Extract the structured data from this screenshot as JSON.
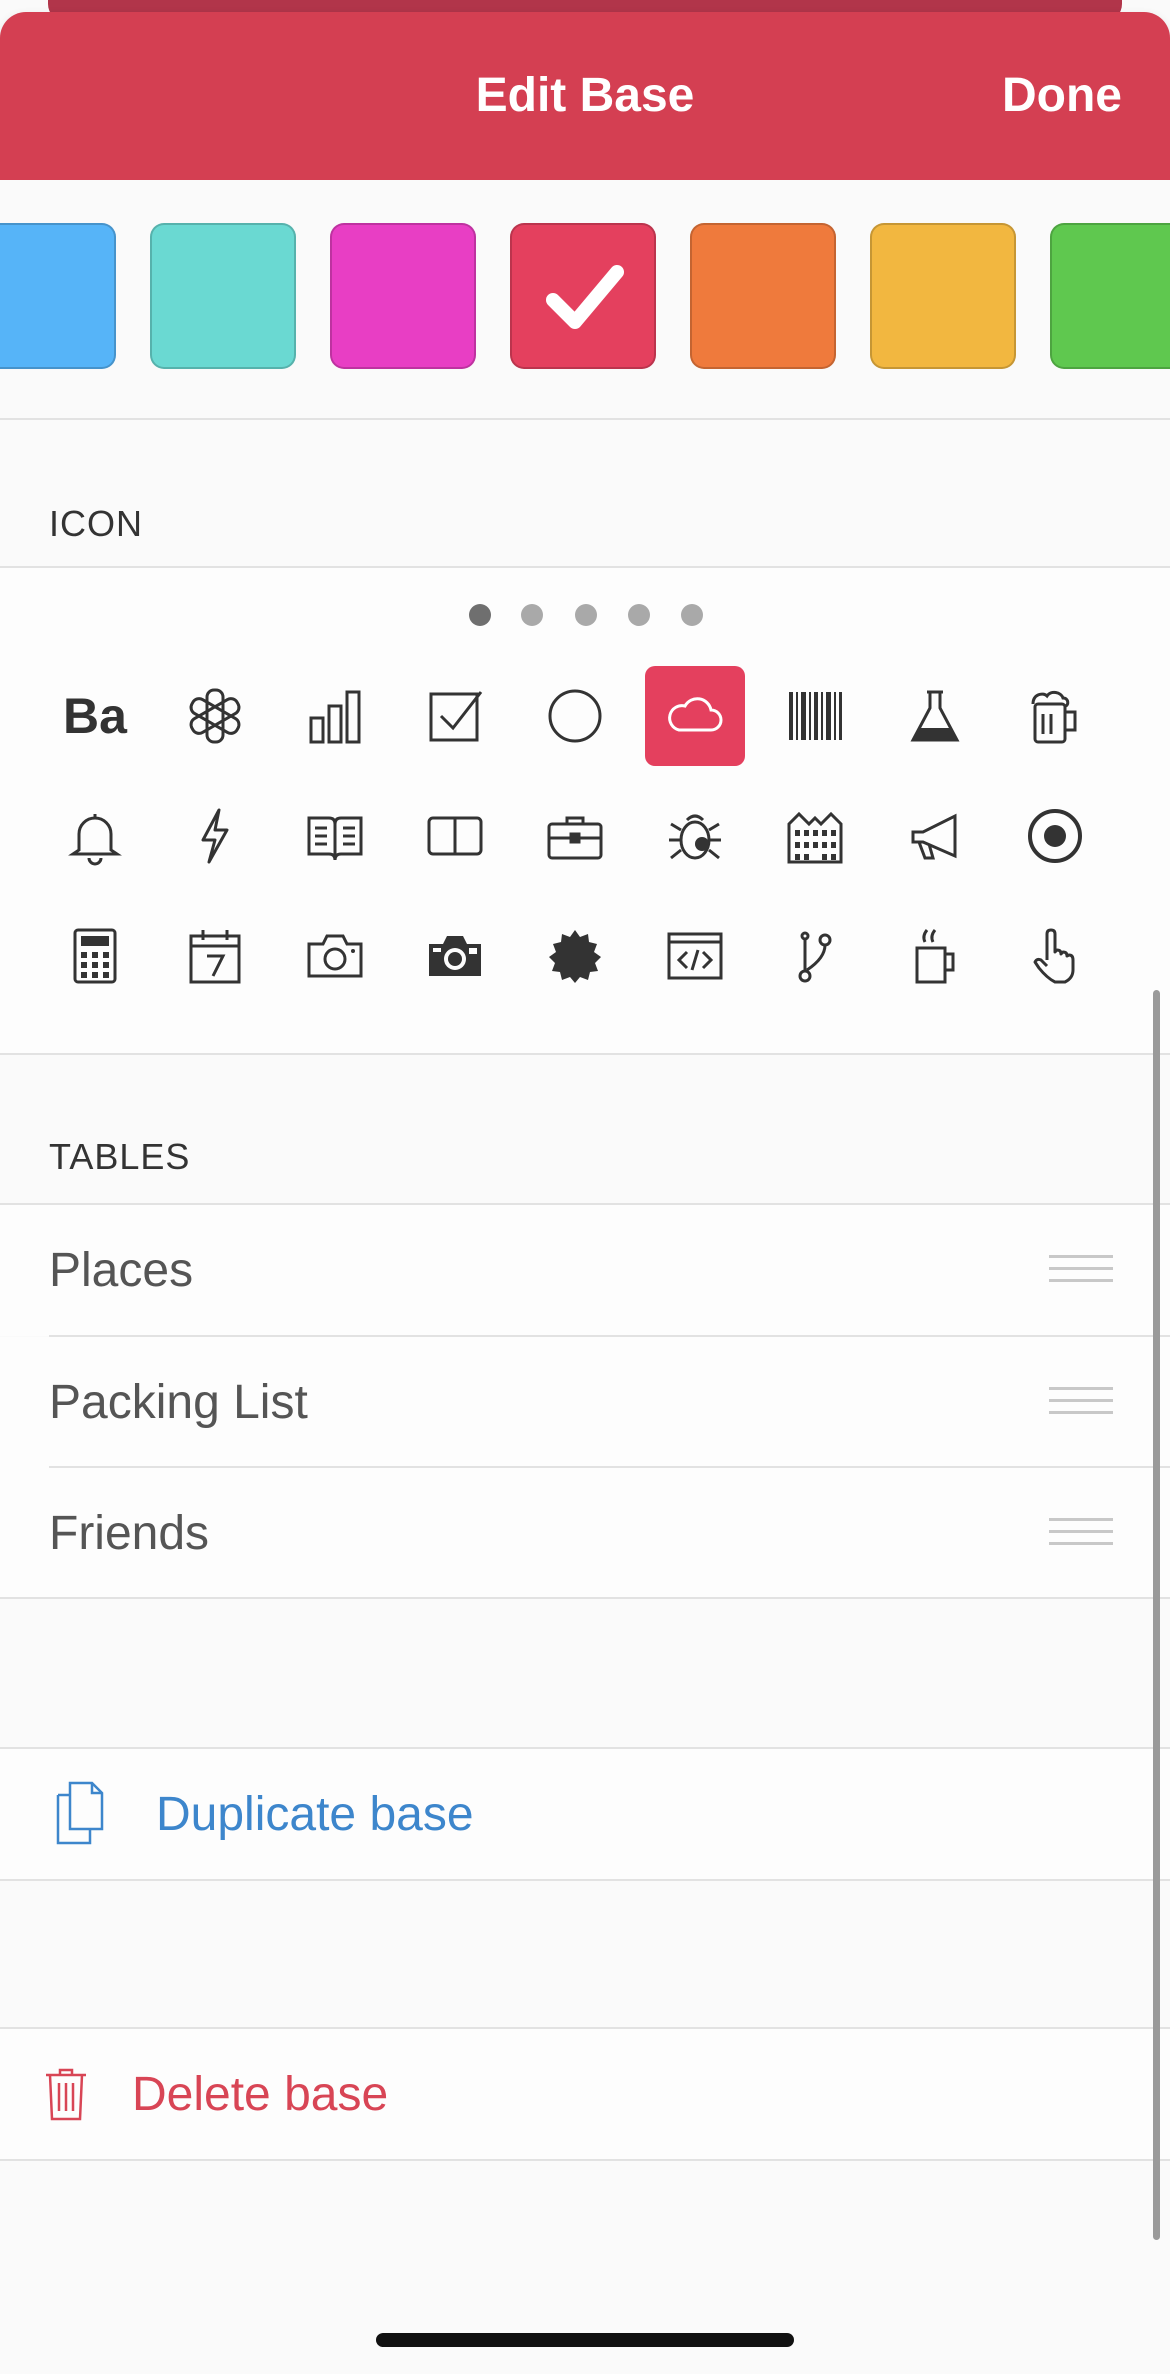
{
  "header": {
    "title": "Edit Base",
    "done_label": "Done",
    "background": "#d43f52"
  },
  "colors": {
    "swatches": [
      {
        "name": "blue",
        "hex": "#56b4f8",
        "selected": false
      },
      {
        "name": "teal",
        "hex": "#6ad9d2",
        "selected": false
      },
      {
        "name": "pink",
        "hex": "#e83ec4",
        "selected": false
      },
      {
        "name": "red",
        "hex": "#e4405e",
        "selected": true
      },
      {
        "name": "orange",
        "hex": "#ef7a3c",
        "selected": false
      },
      {
        "name": "yellow",
        "hex": "#f2b740",
        "selected": false
      },
      {
        "name": "green",
        "hex": "#5fc84f",
        "selected": false
      }
    ]
  },
  "icon_section": {
    "label": "ICON",
    "pages": 5,
    "active_page": 1,
    "icons": [
      [
        "ba-text",
        "asterisk",
        "bar-chart",
        "checkbox",
        "circle",
        "cloud",
        "barcode",
        "flask",
        "beer"
      ],
      [
        "bell",
        "bolt",
        "book-open",
        "book",
        "briefcase",
        "bug",
        "building",
        "megaphone",
        "target"
      ],
      [
        "calculator",
        "calendar",
        "camera",
        "camera-retro",
        "badge",
        "code-window",
        "branch",
        "mug",
        "hand-pointer"
      ]
    ],
    "ba_text": "Ba",
    "selected_icon": "cloud"
  },
  "tables_section": {
    "label": "TABLES",
    "rows": [
      "Places",
      "Packing List",
      "Friends"
    ]
  },
  "actions": {
    "duplicate_label": "Duplicate base",
    "duplicate_color": "#3d86cc",
    "delete_label": "Delete base",
    "delete_color": "#d84555"
  }
}
